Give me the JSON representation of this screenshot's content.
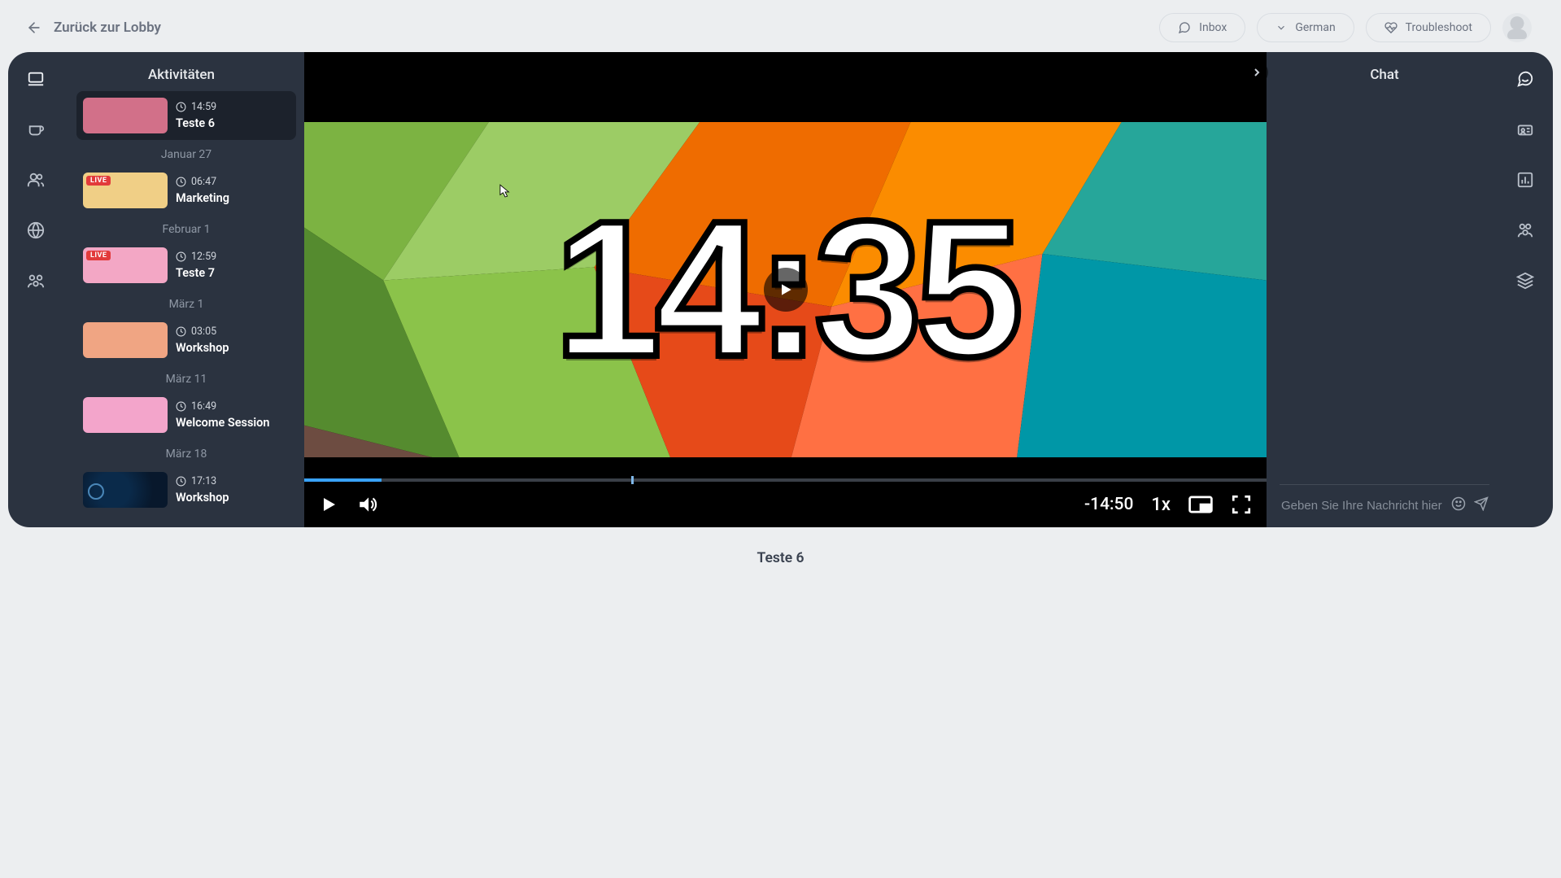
{
  "header": {
    "back_label": "Zurück zur Lobby",
    "inbox_label": "Inbox",
    "language_label": "German",
    "troubleshoot_label": "Troubleshoot"
  },
  "sidebar": {
    "title": "Aktivitäten",
    "live_badge": "LIVE",
    "groups": [
      {
        "activity": {
          "time": "14:59",
          "title": "Teste 6",
          "color": "#d27089",
          "live": false,
          "selected": true
        }
      },
      {
        "date": "Januar 27"
      },
      {
        "activity": {
          "time": "06:47",
          "title": "Marketing",
          "color": "#f0cf86",
          "live": true
        }
      },
      {
        "date": "Februar 1"
      },
      {
        "activity": {
          "time": "12:59",
          "title": "Teste 7",
          "color": "#f3a7c5",
          "live": true
        }
      },
      {
        "date": "März 1"
      },
      {
        "activity": {
          "time": "03:05",
          "title": "Workshop",
          "color": "#f0a583",
          "live": false
        }
      },
      {
        "date": "März 11"
      },
      {
        "activity": {
          "time": "16:49",
          "title": "Welcome Session",
          "color": "#f3a5cb",
          "live": false
        }
      },
      {
        "date": "März 18"
      },
      {
        "activity": {
          "time": "17:13",
          "title": "Workshop",
          "color": "dark",
          "live": false
        }
      }
    ]
  },
  "video": {
    "poster_time": "14:35",
    "remaining": "-14:50",
    "speed": "1x",
    "progress_pct": 8,
    "scrub_marker_pct": 34
  },
  "chat": {
    "title": "Chat",
    "placeholder": "Geben Sie Ihre Nachricht hier ein"
  },
  "session_title": "Teste 6"
}
